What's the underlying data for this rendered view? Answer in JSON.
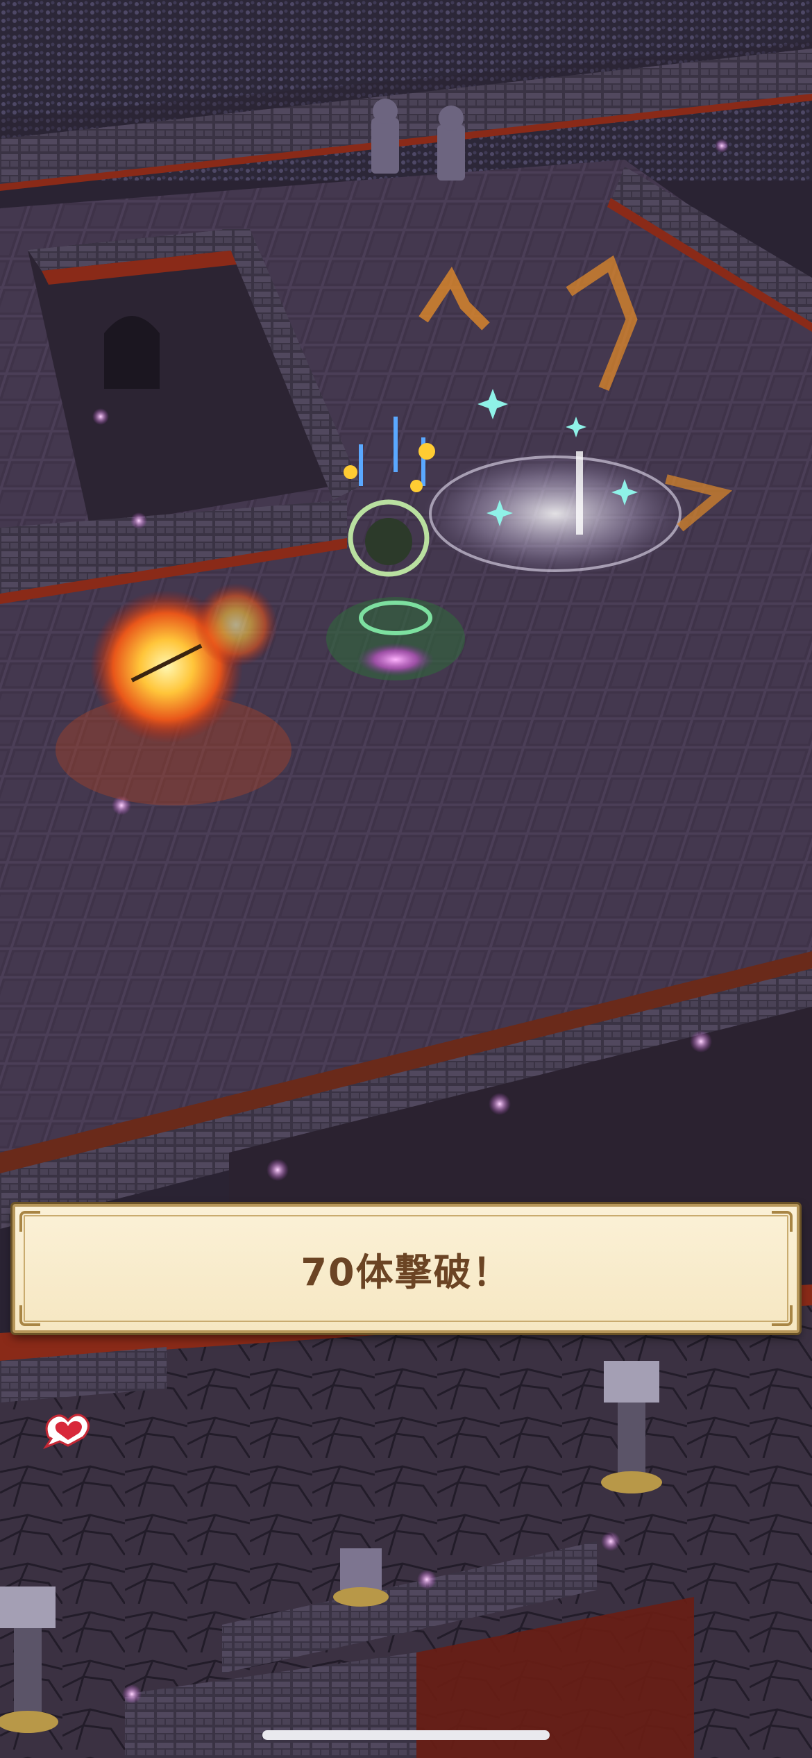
{
  "banner": {
    "message": "70体撃破！"
  },
  "icons": {
    "side_icon": "heart-chat-icon"
  },
  "colors": {
    "banner_bg": "#f6e7c2",
    "banner_border": "#b7975a",
    "banner_text": "#6b4424",
    "floor": "#4a3d55",
    "lava": "#8a2a18"
  }
}
